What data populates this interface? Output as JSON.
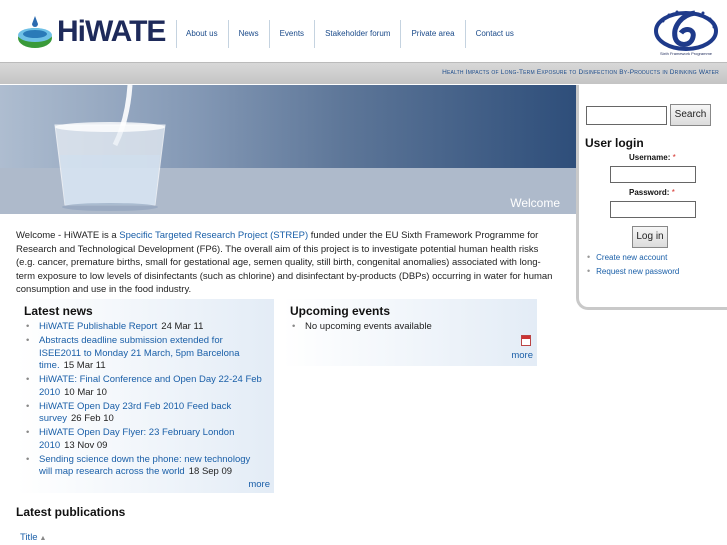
{
  "header": {
    "logo_text": "HiWATE",
    "nav": [
      "About us",
      "News",
      "Events",
      "Stakeholder forum",
      "Private area",
      "Contact us"
    ],
    "fp6_caption": "Sixth Framework Programme"
  },
  "tagline": "Health Impacts of Long-Term Exposure to Disinfection By-Products in Drinking Water",
  "hero": {
    "caption": "Welcome"
  },
  "sidebar": {
    "search_button": "Search",
    "login_title": "User login",
    "username_label": "Username:",
    "password_label": "Password:",
    "required_mark": "*",
    "login_button": "Log in",
    "links": [
      "Create new account",
      "Request new password"
    ]
  },
  "intro": {
    "lead": "Welcome - HiWATE is a ",
    "link": "Specific Targeted Research Project (STREP)",
    "rest": " funded under the EU Sixth Framework Programme for Research and Technological Development (FP6). The overall aim of this project is to investigate potential human health risks (e.g. cancer, premature births, small for gestational age, semen quality, still birth, congenital anomalies) associated with long-term exposure to low levels of disinfectants (such as chlorine) and disinfectant by-products (DBPs) occurring in water for human consumption and use in the food industry."
  },
  "latest_news": {
    "title": "Latest news",
    "items": [
      {
        "title": "HiWATE Publishable Report",
        "date": "24 Mar 11"
      },
      {
        "title": "Abstracts deadline submission extended for ISEE2011 to Monday 21 March, 5pm Barcelona time.",
        "date": "15 Mar 11"
      },
      {
        "title": "HiWATE: Final Conference and Open Day 22-24 Feb 2010",
        "date": "10 Mar 10"
      },
      {
        "title": "HiWATE Open Day 23rd Feb 2010 Feed back survey",
        "date": "26 Feb 10"
      },
      {
        "title": "HiWATE Open Day Flyer: 23 February London 2010",
        "date": "13 Nov 09"
      },
      {
        "title": "Sending science down the phone: new technology will map research across the world",
        "date": "18 Sep 09"
      }
    ],
    "more": "more"
  },
  "upcoming_events": {
    "title": "Upcoming events",
    "empty_text": "No upcoming events available",
    "more": "more"
  },
  "latest_publications": {
    "title": "Latest publications",
    "column": "Title"
  },
  "colors": {
    "link": "#1a5fa8",
    "logo": "#1e2a5a",
    "required": "#d4302a"
  }
}
